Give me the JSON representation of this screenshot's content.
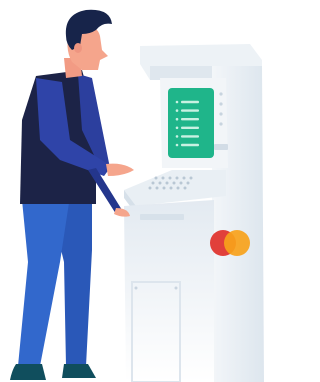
{
  "scene": {
    "colors": {
      "kiosk_body": "#e6edf3",
      "kiosk_shade": "#d3dee8",
      "screen": "#1fb58a",
      "skin": "#f5a58c",
      "hair": "#17244a",
      "sweater": "#2c3f9e",
      "vest": "#1c2347",
      "pants": "#2f62c7",
      "shoes": "#0f4f5e",
      "card_red": "#e1403b",
      "card_orange": "#f7a21b"
    },
    "screen_rows": 6
  }
}
